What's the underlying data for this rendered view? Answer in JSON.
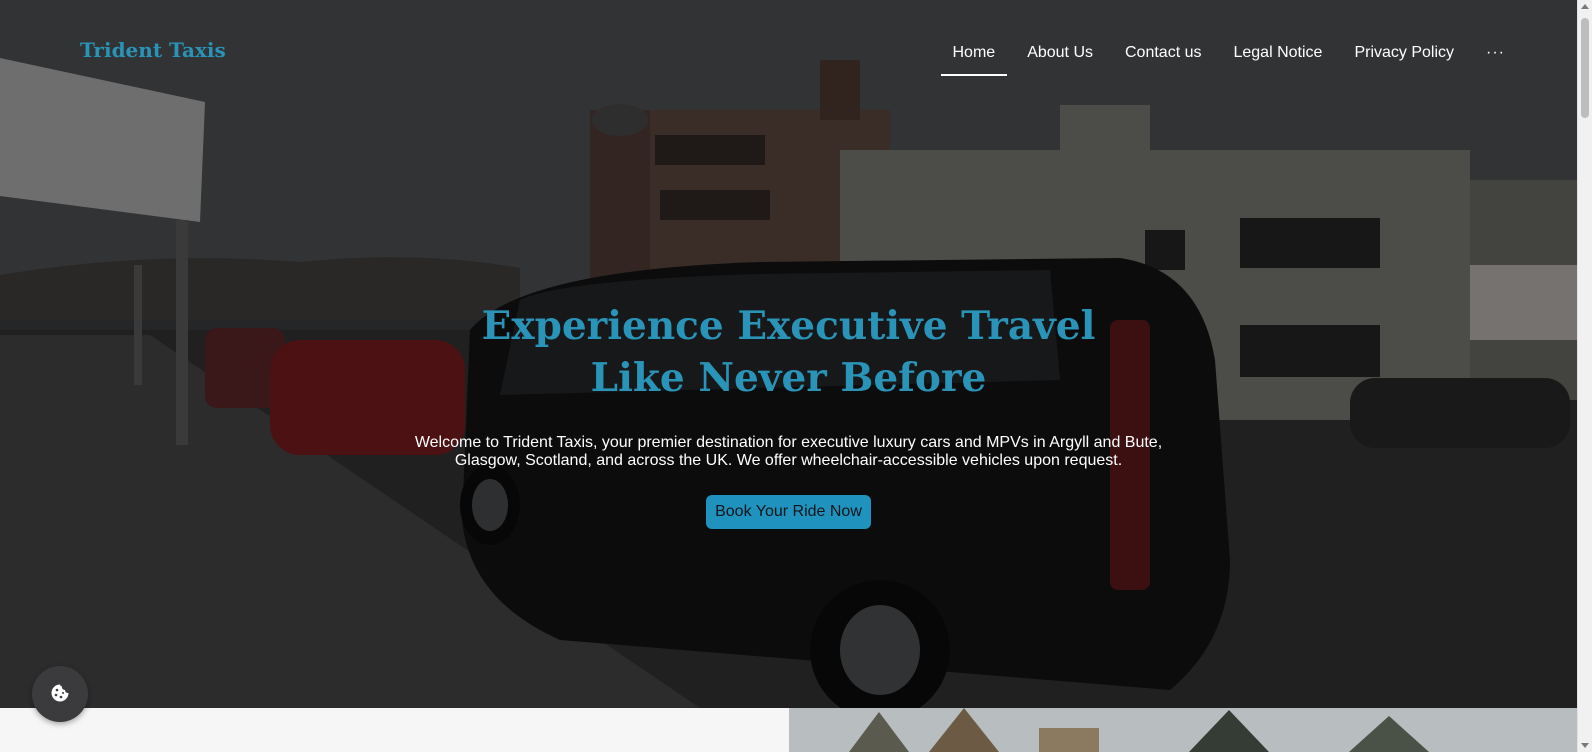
{
  "brand": {
    "name": "Trident Taxis",
    "color": "#2a93b8"
  },
  "nav": {
    "items": [
      {
        "label": "Home",
        "active": true
      },
      {
        "label": "About Us",
        "active": false
      },
      {
        "label": "Contact us",
        "active": false
      },
      {
        "label": "Legal Notice",
        "active": false
      },
      {
        "label": "Privacy Policy",
        "active": false
      }
    ],
    "more_label": "···"
  },
  "hero": {
    "headline": "Experience Executive Travel Like Never Before",
    "subtext": "Welcome to Trident Taxis, your premier destination for executive luxury cars and MPVs in Argyll and Bute, Glasgow, Scotland, and across the UK. We offer wheelchair-accessible vehicles upon request.",
    "cta_label": "Book Your Ride Now",
    "background_image": "dark minibus parked on street by town buildings",
    "headline_color": "#2a93b8",
    "cta_color": "#1f93bd"
  },
  "cookie_button": {
    "icon": "cookie-icon"
  }
}
